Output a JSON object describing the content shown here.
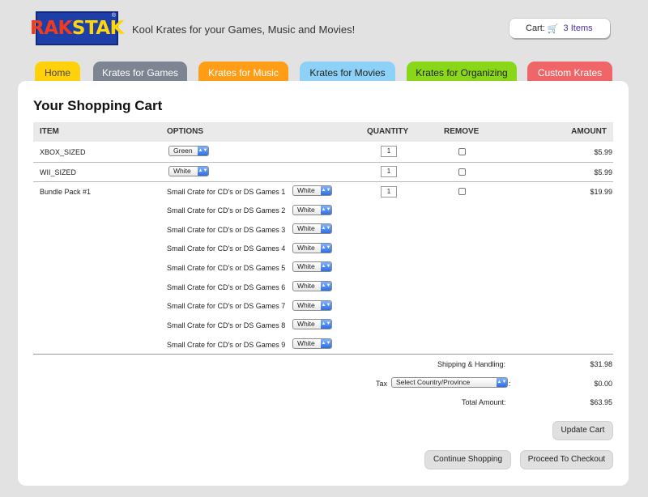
{
  "header": {
    "logo": {
      "part1": "RAK",
      "part2": "STAK",
      "reg": "®"
    },
    "tagline": "Kool Krates for your Games, Music and Movies!",
    "cart": {
      "label": "Cart:",
      "count": "3 Items",
      "icon": "cart-icon"
    }
  },
  "nav": {
    "tabs": [
      {
        "label": "Home",
        "color": "#ffd10a"
      },
      {
        "label": "Krates for Games",
        "color": "#7c8591"
      },
      {
        "label": "Krates for Music",
        "color": "#ff9d16"
      },
      {
        "label": "Krates for Movies",
        "color": "#8dd1f6"
      },
      {
        "label": "Krates for Organizing",
        "color": "#8ad71a"
      },
      {
        "label": "Custom Krates",
        "color": "#f06668"
      }
    ]
  },
  "cart_page": {
    "title": "Your Shopping Cart",
    "columns": {
      "item": "ITEM",
      "options": "OPTIONS",
      "quantity": "QUANTITY",
      "remove": "REMOVE",
      "amount": "AMOUNT"
    },
    "rows": [
      {
        "item": "XBOX_SIZED",
        "option": "Green",
        "qty": "1",
        "amount": "$5.99"
      },
      {
        "item": "WII_SIZED",
        "option": "White",
        "qty": "1",
        "amount": "$5.99"
      },
      {
        "item": "Bundle Pack #1",
        "qty": "1",
        "amount": "$19.99",
        "sub_items": [
          {
            "label": "Small Crate for CD's or DS Games 1",
            "option": "White"
          },
          {
            "label": "Small Crate for CD's or DS Games 2",
            "option": "White"
          },
          {
            "label": "Small Crate for CD's or DS Games 3",
            "option": "White"
          },
          {
            "label": "Small Crate for CD's or DS Games 4",
            "option": "White"
          },
          {
            "label": "Small Crate for CD's or DS Games 5",
            "option": "White"
          },
          {
            "label": "Small Crate for CD's or DS Games 6",
            "option": "White"
          },
          {
            "label": "Small Crate for CD's or DS Games 7",
            "option": "White"
          },
          {
            "label": "Small Crate for CD's or DS Games 8",
            "option": "White"
          },
          {
            "label": "Small Crate for CD's or DS Games 9",
            "option": "White"
          }
        ]
      }
    ],
    "totals": {
      "shipping_label": "Shipping & Handling:",
      "shipping_value": "$31.98",
      "tax_label": "Tax",
      "tax_select": "Select Country/Province",
      "tax_colon": ":",
      "tax_value": "$0.00",
      "total_label": "Total Amount:",
      "total_value": "$63.95"
    },
    "buttons": {
      "update": "Update Cart",
      "continue": "Continue Shopping",
      "checkout": "Proceed To Checkout"
    }
  }
}
